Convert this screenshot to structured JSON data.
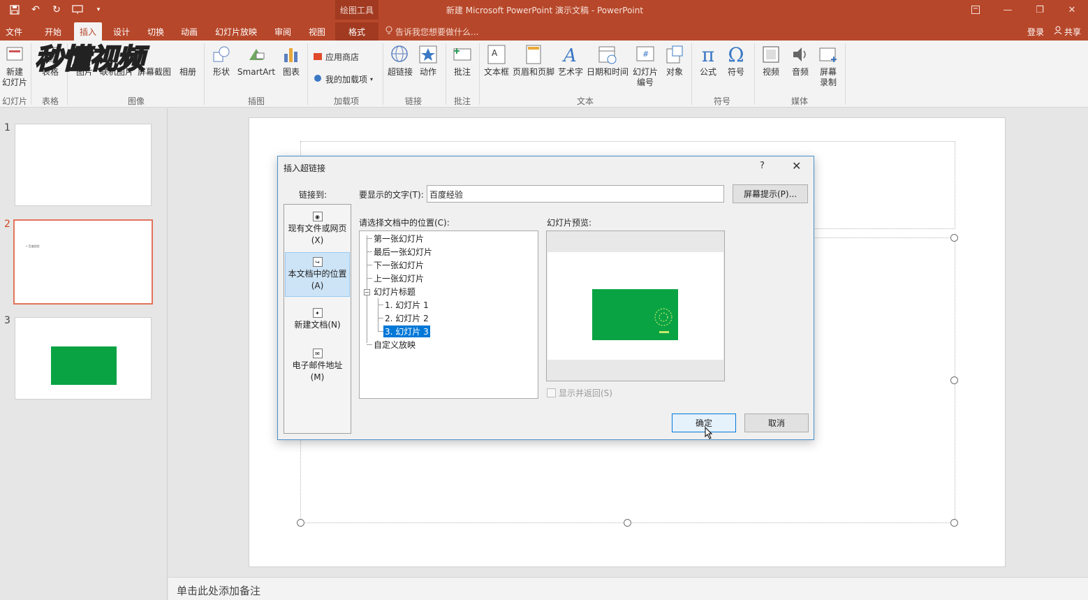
{
  "window": {
    "title": "新建 Microsoft PowerPoint 演示文稿 - PowerPoint",
    "contextual_tab_header": "绘图工具",
    "controls": [
      "ribbon-display-icon",
      "minimize-icon",
      "restore-icon",
      "close-icon"
    ]
  },
  "quick_access": [
    "save-icon",
    "undo-icon",
    "redo-icon",
    "start-presentation-icon",
    "customize-icon"
  ],
  "tabs": [
    {
      "label": "文件"
    },
    {
      "label": "开始"
    },
    {
      "label": "插入"
    },
    {
      "label": "设计"
    },
    {
      "label": "切换"
    },
    {
      "label": "动画"
    },
    {
      "label": "幻灯片放映"
    },
    {
      "label": "审阅"
    },
    {
      "label": "视图"
    },
    {
      "label": "格式"
    }
  ],
  "active_tab": "插入",
  "tellme": "告诉我您想要做什么...",
  "account": {
    "login": "登录",
    "share": "共享"
  },
  "watermark": "秒懂视频",
  "ribbon": {
    "buttons": {
      "new_slide": "新建\n幻灯片",
      "table": "表格",
      "picture": "图片",
      "online_picture": "联机图片",
      "screenshot": "屏幕截图",
      "album": "相册",
      "shapes": "形状",
      "smartart": "SmartArt",
      "chart": "图表",
      "store": "应用商店",
      "my_addins": "我的加载项",
      "hyperlink": "超链接",
      "action": "动作",
      "comment": "批注",
      "textbox": "文本框",
      "header_footer": "页眉和页脚",
      "wordart": "艺术字",
      "datetime": "日期和时间",
      "slide_number": "幻灯片\n编号",
      "object": "对象",
      "equation": "公式",
      "symbol": "符号",
      "video": "视频",
      "audio": "音频",
      "screen_recording": "屏幕\n录制"
    },
    "groups": {
      "slides": "幻灯片",
      "tables": "表格",
      "images": "图像",
      "illustrations": "插图",
      "addins": "加载项",
      "links": "链接",
      "comments": "批注",
      "text": "文本",
      "symbols": "符号",
      "media": "媒体"
    }
  },
  "thumbnails": [
    {
      "number": "1",
      "text": ""
    },
    {
      "number": "2",
      "text": "• 百度经验"
    },
    {
      "number": "3",
      "text": ""
    }
  ],
  "notes_placeholder": "单击此处添加备注",
  "dialog": {
    "title": "插入超链接",
    "help": "?",
    "close": "✕",
    "link_to_label": "链接到:",
    "link_to": [
      {
        "label": "现有文件或网页\n(X)"
      },
      {
        "label": "本文档中的位置\n(A)"
      },
      {
        "label": "新建文档(N)"
      },
      {
        "label": "电子邮件地址\n(M)"
      }
    ],
    "display_text_label": "要显示的文字(T):",
    "display_text_value": "百度经验",
    "screentip_button": "屏幕提示(P)...",
    "place_label": "请选择文档中的位置(C):",
    "tree": {
      "first": "第一张幻灯片",
      "last": "最后一张幻灯片",
      "next": "下一张幻灯片",
      "prev": "上一张幻灯片",
      "titles": "幻灯片标题",
      "expander": "−",
      "slide1": "1. 幻灯片 1",
      "slide2": "2. 幻灯片 2",
      "slide3": "3. 幻灯片 3",
      "custom": "自定义放映"
    },
    "preview_label": "幻灯片预览:",
    "show_return_label": "显示并返回(S)",
    "ok": "确定",
    "cancel": "取消"
  },
  "colors": {
    "accent": "#b7472a",
    "slide_green": "#0aa344",
    "selection": "#0078d7"
  }
}
